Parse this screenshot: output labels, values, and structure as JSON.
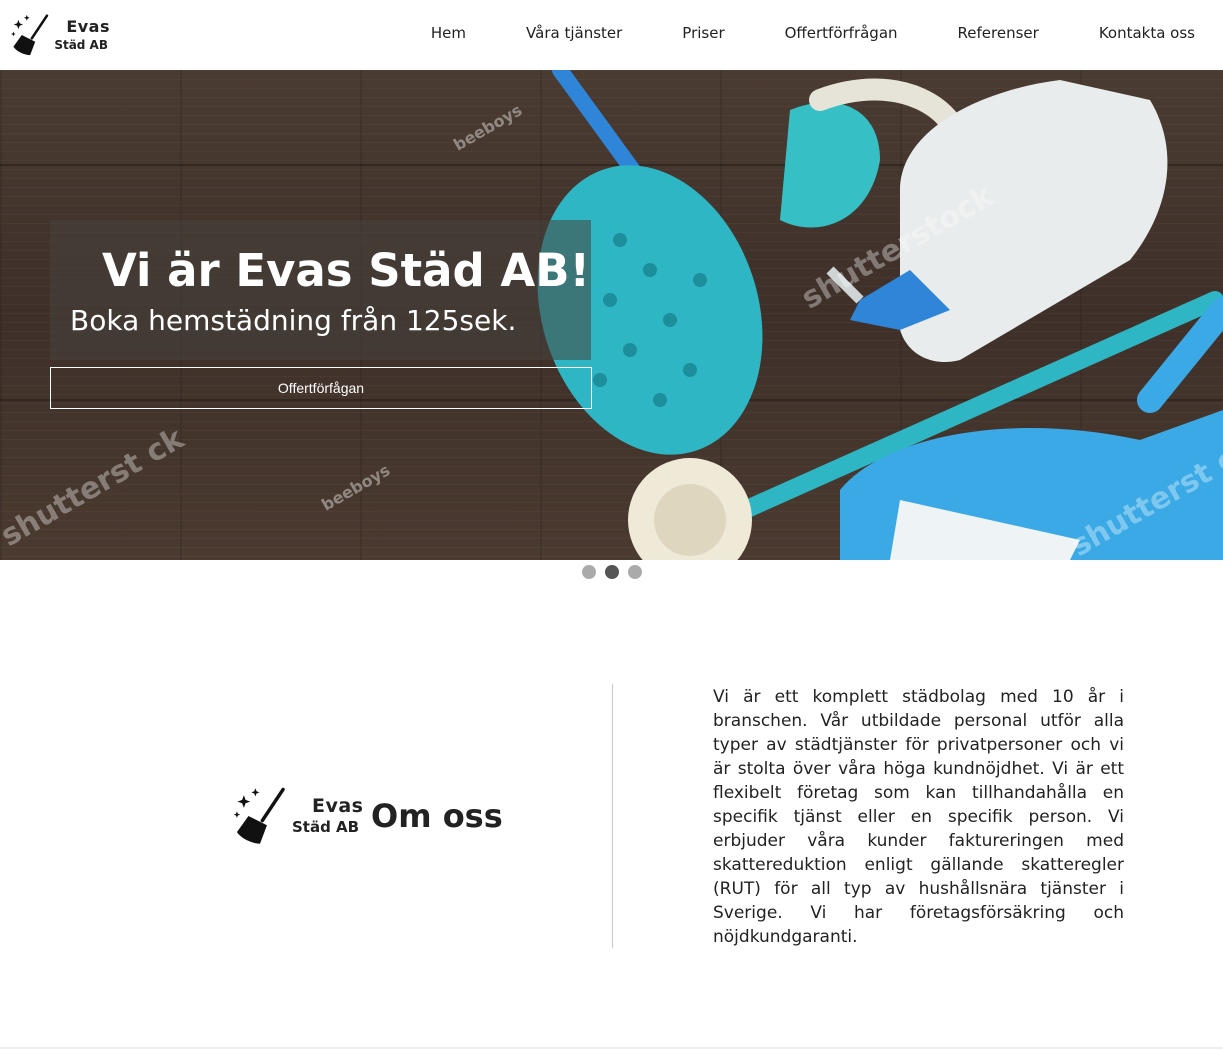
{
  "header": {
    "logo": {
      "line1": "Evas",
      "line2": "Städ AB"
    },
    "nav": [
      {
        "label": "Hem"
      },
      {
        "label": "Våra tjänster"
      },
      {
        "label": "Priser"
      },
      {
        "label": "Offertförfrågan"
      },
      {
        "label": "Referenser"
      },
      {
        "label": "Kontakta oss"
      }
    ]
  },
  "hero": {
    "title": "Vi är Evas Städ AB!",
    "subtitle": "Boka hemstädning från 125sek.",
    "button_label": "Offertförfågan",
    "watermarks": [
      "shutterstock",
      "beeboys",
      "shutterst ck",
      "beeboys",
      "shutterst ck"
    ]
  },
  "carousel": {
    "slide_count": 3,
    "active_index": 1
  },
  "about": {
    "logo": {
      "line1": "Evas",
      "line2": "Städ AB"
    },
    "title": "Om oss",
    "text": "Vi är ett komplett städbolag med 10 år i branschen. Vår utbildade personal utför alla typer av städtjänster för privatpersoner och vi är stolta över våra höga kundnöjdhet. Vi är ett flexibelt företag som kan tillhandahålla en specifik tjänst eller en specifik person. Vi erbjuder våra kunder faktureringen med skattereduktion enligt gällande skatteregler (RUT) för all typ av hushållsnära tjänster i Sverige. Vi har företagsförsäkring och nöjdkundgaranti."
  },
  "colors": {
    "accent_teal": "#2fb6c4",
    "blue": "#2f9fe0",
    "wood": "#3e3029"
  },
  "icons": [
    "broom-icon",
    "sparkle-icon"
  ]
}
